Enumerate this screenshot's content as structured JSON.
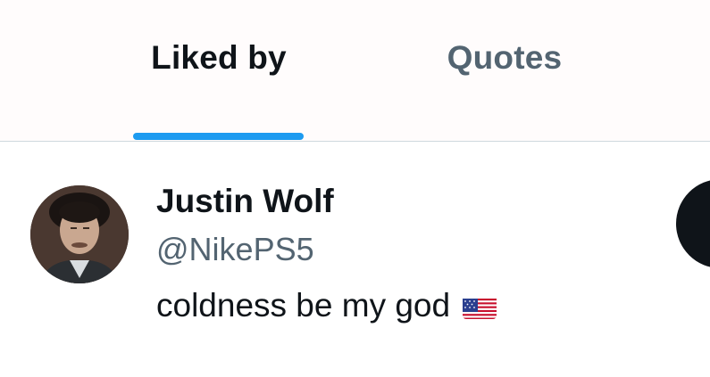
{
  "tabs": [
    {
      "label": "Liked by",
      "active": true
    },
    {
      "label": "Quotes",
      "active": false
    }
  ],
  "user": {
    "display_name": "Justin Wolf",
    "handle": "@NikePS5",
    "bio": "coldness be my god",
    "bio_emoji": "us-flag-emoji",
    "avatar_icon": "user-avatar"
  },
  "colors": {
    "accent": "#1d9bf0",
    "text_primary": "#0f1419",
    "text_secondary": "#536471",
    "divider": "#cfd9de",
    "follow_button": "#0f1419"
  }
}
